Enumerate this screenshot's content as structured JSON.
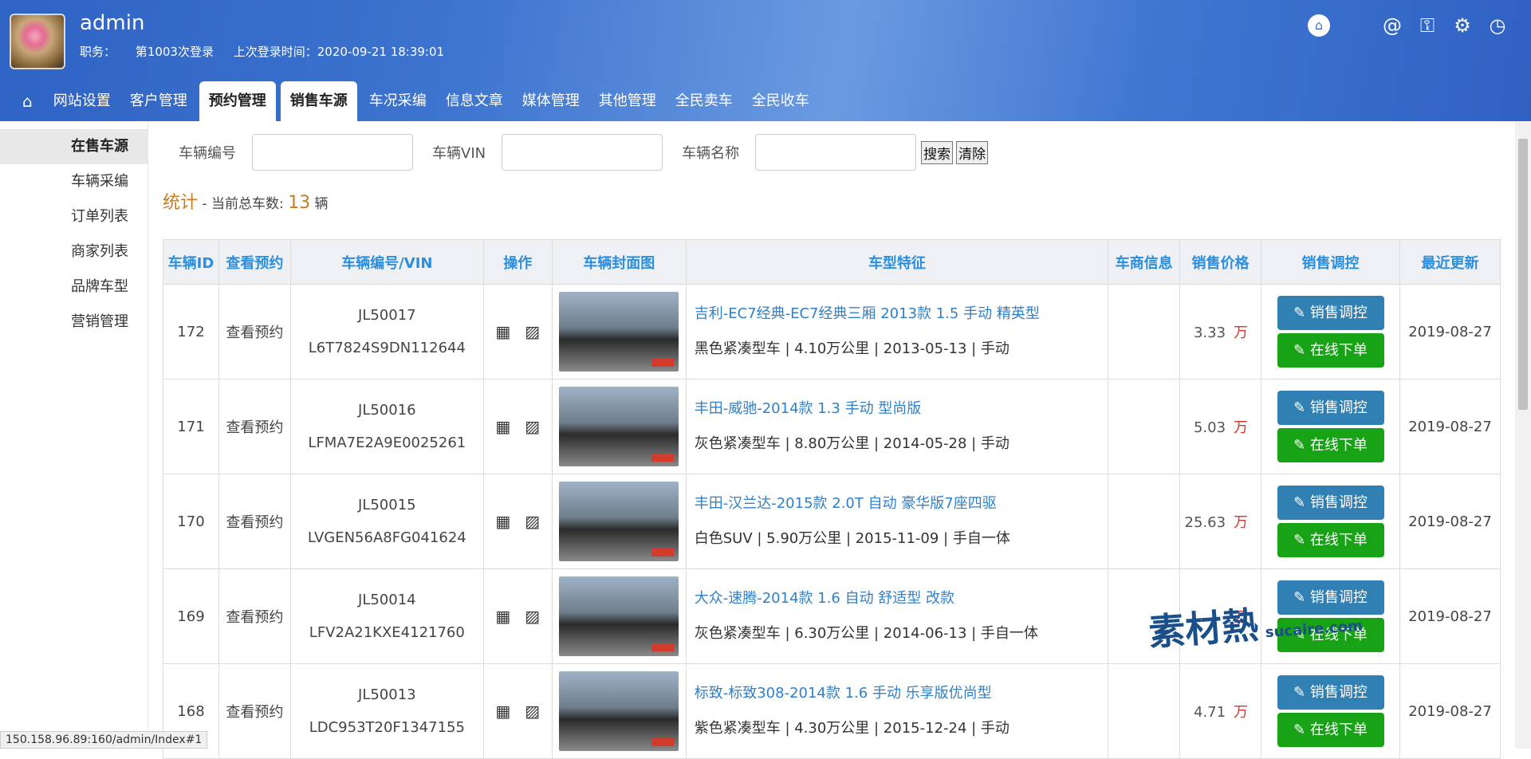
{
  "header": {
    "username": "admin",
    "role_label": "职务：",
    "login_count": "第1003次登录",
    "last_login": "上次登录时间：2020-09-21 18:39:01"
  },
  "nav": {
    "items": [
      "网站设置",
      "客户管理",
      "预约管理",
      "销售车源",
      "车况采编",
      "信息文章",
      "媒体管理",
      "其他管理",
      "全民卖车",
      "全民收车"
    ]
  },
  "sidebar": {
    "items": [
      "在售车源",
      "车辆采编",
      "订单列表",
      "商家列表",
      "品牌车型",
      "营销管理"
    ]
  },
  "search": {
    "label_no": "车辆编号",
    "label_vin": "车辆VIN",
    "label_name": "车辆名称",
    "btn_search": "搜索",
    "btn_clear": "清除"
  },
  "stats": {
    "title": "统计",
    "text": " - 当前总车数:",
    "count": "13",
    "unit": "辆"
  },
  "table": {
    "headers": [
      "车辆ID",
      "查看预约",
      "车辆编号/VIN",
      "操作",
      "车辆封面图",
      "车型特征",
      "车商信息",
      "销售价格",
      "销售调控",
      "最近更新"
    ],
    "rows": [
      {
        "id": "172",
        "book": "查看预约",
        "no": "JL50017",
        "vin": "L6T7824S9DN112644",
        "model": "吉利-EC7经典-EC7经典三厢 2013款 1.5 手动 精英型",
        "detail": "黑色紧凑型车 | 4.10万公里 | 2013-05-13 | 手动",
        "dealer": "",
        "price": "3.33",
        "wan": "万",
        "ctl": "销售调控",
        "order": "在线下单",
        "date": "2019-08-27"
      },
      {
        "id": "171",
        "book": "查看预约",
        "no": "JL50016",
        "vin": "LFMA7E2A9E0025261",
        "model": "丰田-威驰-2014款 1.3 手动 型尚版",
        "detail": "灰色紧凑型车 | 8.80万公里 | 2014-05-28 | 手动",
        "dealer": "",
        "price": "5.03",
        "wan": "万",
        "ctl": "销售调控",
        "order": "在线下单",
        "date": "2019-08-27"
      },
      {
        "id": "170",
        "book": "查看预约",
        "no": "JL50015",
        "vin": "LVGEN56A8FG041624",
        "model": "丰田-汉兰达-2015款 2.0T 自动 豪华版7座四驱",
        "detail": "白色SUV | 5.90万公里 | 2015-11-09 | 手自一体",
        "dealer": "",
        "price": "25.63",
        "wan": "万",
        "ctl": "销售调控",
        "order": "在线下单",
        "date": "2019-08-27"
      },
      {
        "id": "169",
        "book": "查看预约",
        "no": "JL50014",
        "vin": "LFV2A21KXE4121760",
        "model": "大众-速腾-2014款 1.6 自动 舒适型 改款",
        "detail": "灰色紧凑型车 | 6.30万公里 | 2014-06-13 | 手自一体",
        "dealer": "",
        "price": "",
        "wan": "万",
        "ctl": "销售调控",
        "order": "在线下单",
        "date": "2019-08-27"
      },
      {
        "id": "168",
        "book": "查看预约",
        "no": "JL50013",
        "vin": "LDC953T20F1347155",
        "model": "标致-标致308-2014款 1.6 手动 乐享版优尚型",
        "detail": "紫色紧凑型车 | 4.30万公里 | 2015-12-24 | 手动",
        "dealer": "",
        "price": "4.71",
        "wan": "万",
        "ctl": "销售调控",
        "order": "在线下单",
        "date": "2019-08-27"
      }
    ]
  },
  "status_url": "150.158.96.89:160/admin/Index#1",
  "watermark": {
    "text": "素材熱",
    "sub": "sucaire.com"
  },
  "colors": {
    "header_blue": "#3d74cf",
    "link": "#2f80c8",
    "ctl_blue": "#3180b4",
    "order_green": "#18a317",
    "price_red": "#d9332a",
    "stats_orange": "#c87c20"
  }
}
